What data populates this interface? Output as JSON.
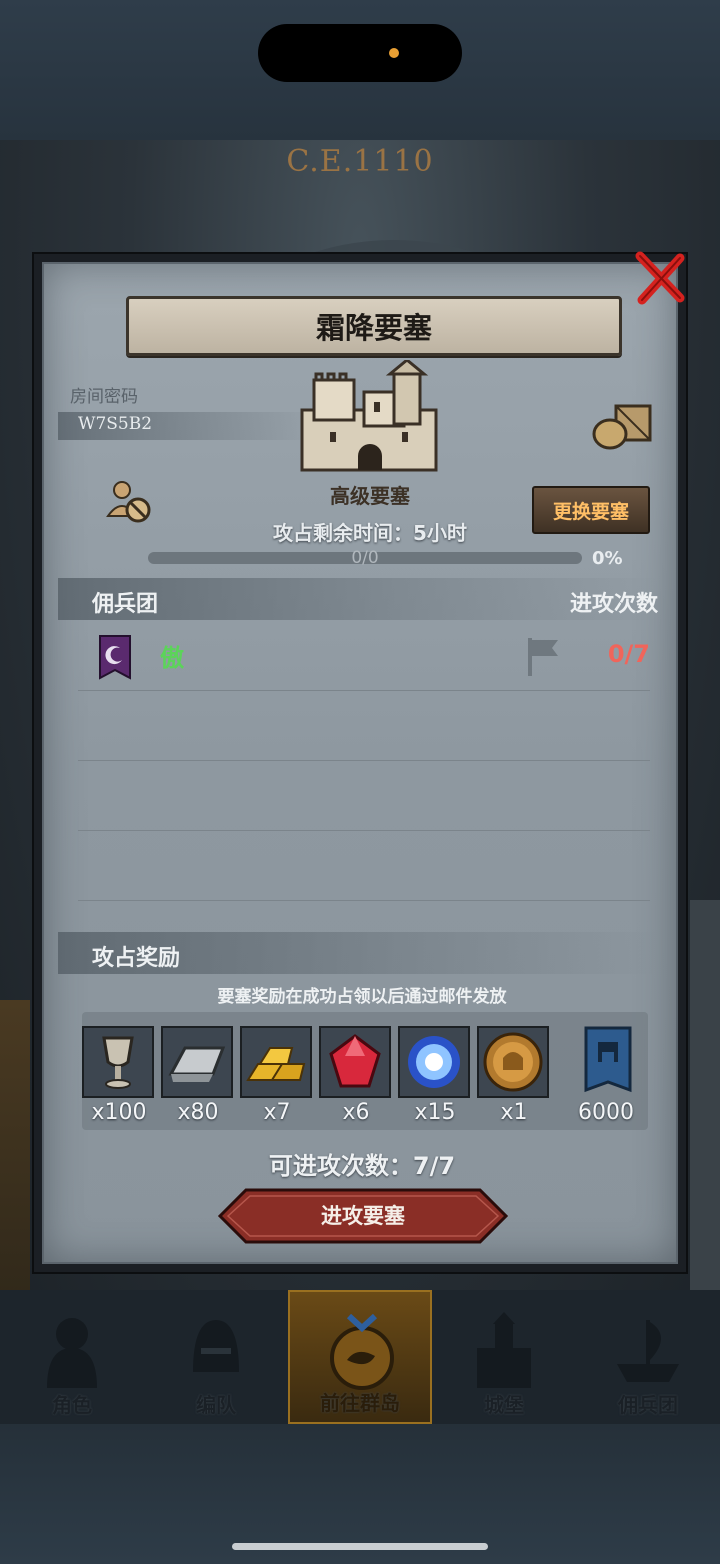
{
  "app": {
    "era": "C.E.1110"
  },
  "dialog": {
    "title": "霜降要塞",
    "room_password_label": "房间密码",
    "room_password": "W7S5B2",
    "fort_level": "高级要塞",
    "time_left": "攻占剩余时间：5小时",
    "change_fort_label": "更换要塞",
    "progress_text": "0/0",
    "progress_percent": "0%",
    "progress_fraction": 0,
    "mercenary_header": "佣兵团",
    "attack_count_header": "进攻次数",
    "mercenaries": [
      {
        "name": "傲",
        "attacks": "0/7"
      }
    ],
    "rewards_header": "攻占奖励",
    "rewards_note": "要塞奖励在成功占领以后通过邮件发放",
    "rewards": [
      {
        "icon": "goblet-icon",
        "qty": "x100"
      },
      {
        "icon": "iron-ingot-icon",
        "qty": "x80"
      },
      {
        "icon": "gold-bars-icon",
        "qty": "x7"
      },
      {
        "icon": "ruby-icon",
        "qty": "x6"
      },
      {
        "icon": "blue-crystal-icon",
        "qty": "x15"
      },
      {
        "icon": "knight-coin-icon",
        "qty": "x1"
      },
      {
        "icon": "castle-banner-icon",
        "qty": "6000"
      }
    ],
    "attacks_available": "可进攻次数：7/7",
    "attack_button_label": "进攻要塞"
  },
  "nav": {
    "items": [
      {
        "label": "角色",
        "icon": "knight-icon"
      },
      {
        "label": "编队",
        "icon": "helmet-icon"
      },
      {
        "label": "前往群岛",
        "icon": "island-map-icon",
        "active": true
      },
      {
        "label": "城堡",
        "icon": "castle-icon"
      },
      {
        "label": "佣兵团",
        "icon": "ship-icon"
      }
    ]
  },
  "colors": {
    "guild_name": "#5cd35a",
    "attack_count": "#f0655b",
    "change_button_text": "#ffbf66",
    "close_x": "#d5221f",
    "attack_button": "#8a2e26"
  }
}
